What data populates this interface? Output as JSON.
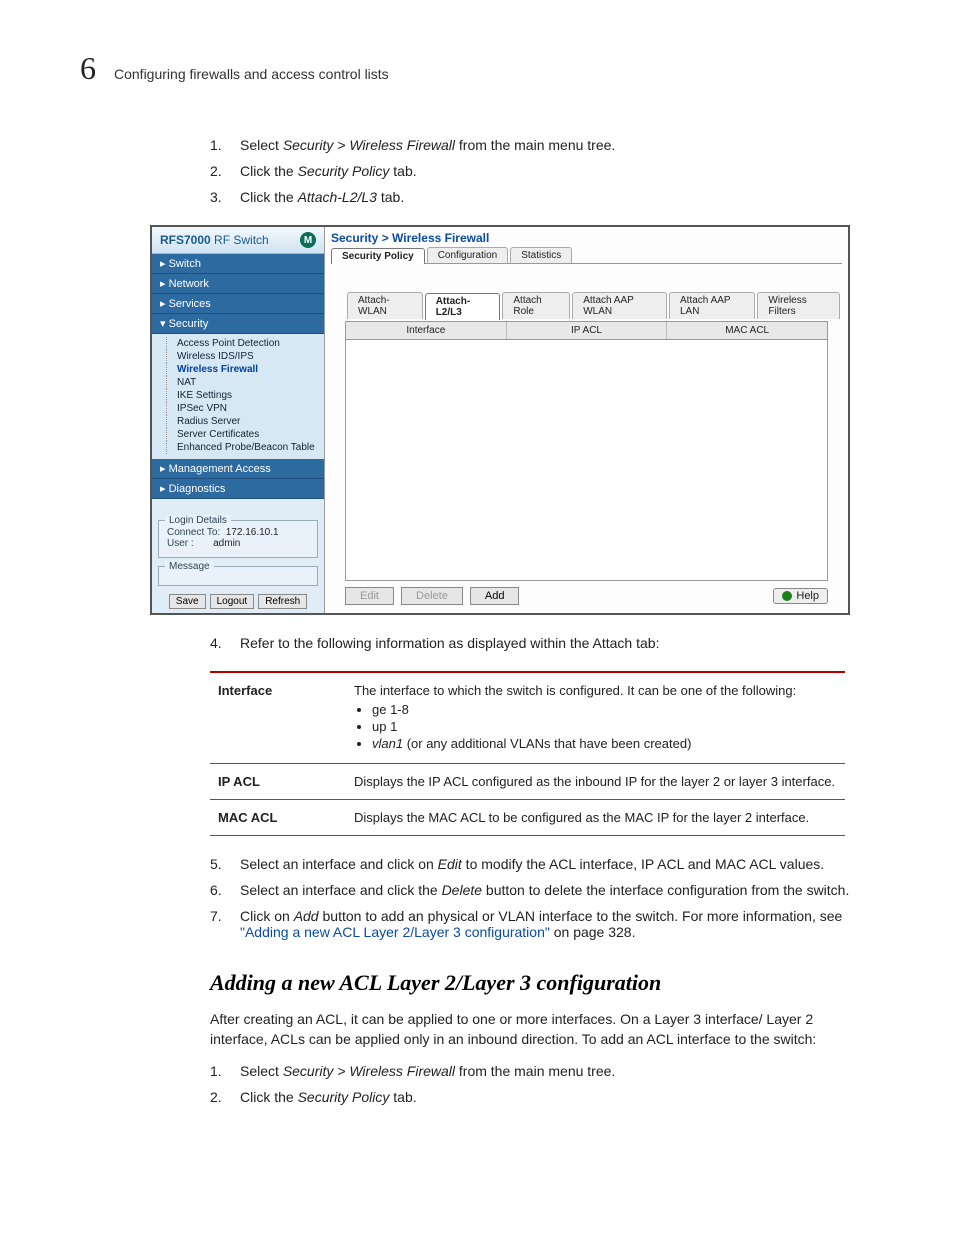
{
  "header": {
    "chapter": "6",
    "title": "Configuring firewalls and access control lists"
  },
  "steps1": [
    {
      "n": "1.",
      "pre": "Select ",
      "em": "Security > Wireless Firewall",
      "post": " from the main menu tree."
    },
    {
      "n": "2.",
      "pre": "Click the ",
      "em": "Security Policy",
      "post": " tab."
    },
    {
      "n": "3.",
      "pre": "Click the ",
      "em": "Attach-L2/L3",
      "post": " tab."
    }
  ],
  "screenshot": {
    "product_a": "RFS7000",
    "product_b": " RF Switch",
    "nav": {
      "switch": "Switch",
      "network": "Network",
      "services": "Services",
      "security": "Security",
      "mgmt": "Management Access",
      "diag": "Diagnostics"
    },
    "tree": {
      "apd": "Access Point Detection",
      "wids": "Wireless IDS/IPS",
      "wf": "Wireless Firewall",
      "nat": "NAT",
      "ike": "IKE Settings",
      "ipsec": "IPSec VPN",
      "radius": "Radius Server",
      "certs": "Server Certificates",
      "probe": "Enhanced Probe/Beacon Table"
    },
    "login": {
      "title": "Login Details",
      "connect_lbl": "Connect To:",
      "connect_val": "172.16.10.1",
      "user_lbl": "User :",
      "user_val": "admin"
    },
    "msg": {
      "title": "Message"
    },
    "btns": {
      "save": "Save",
      "logout": "Logout",
      "refresh": "Refresh"
    },
    "crumb": "Security > Wireless Firewall",
    "top_tabs": {
      "sp": "Security Policy",
      "cfg": "Configuration",
      "stats": "Statistics"
    },
    "sub_tabs": {
      "awlan": "Attach-WLAN",
      "al23": "Attach-L2/L3",
      "arole": "Attach Role",
      "aaapw": "Attach AAP WLAN",
      "aaapl": "Attach AAP LAN",
      "wfilt": "Wireless Filters"
    },
    "cols": {
      "iface": "Interface",
      "ipacl": "IP ACL",
      "macacl": "MAC ACL"
    },
    "actions": {
      "edit": "Edit",
      "delete": "Delete",
      "add": "Add",
      "help": "Help"
    }
  },
  "step4": {
    "n": "4.",
    "text": "Refer to the following information as displayed within the Attach tab:"
  },
  "table": {
    "r1": {
      "k": "Interface",
      "desc": "The interface to which the switch is configured. It can be one of the following:",
      "b1": "ge 1-8",
      "b2": "up 1",
      "b3a": "vlan1",
      "b3b": " (or any additional VLANs that have been created)"
    },
    "r2": {
      "k": "IP ACL",
      "desc": "Displays the IP ACL configured as the inbound IP for the layer 2 or layer 3 interface."
    },
    "r3": {
      "k": "MAC ACL",
      "desc": "Displays the MAC ACL to be configured as the MAC IP for the layer 2 interface."
    }
  },
  "steps2": [
    {
      "n": "5.",
      "pre": "Select an interface and click on ",
      "em": "Edit",
      "post": " to modify the ACL interface, IP ACL and MAC ACL values."
    },
    {
      "n": "6.",
      "pre": "Select an interface and click the ",
      "em": "Delete",
      "post": " button to delete the interface configuration from the switch."
    }
  ],
  "step7": {
    "n": "7.",
    "pre": "Click on ",
    "em": "Add",
    "mid": " button to add an physical or VLAN interface to the switch. For more information, see ",
    "link": "\"Adding a new ACL Layer 2/Layer 3 configuration\"",
    "post": " on page 328."
  },
  "section": "Adding a new ACL Layer 2/Layer 3 configuration",
  "para": "After creating an ACL, it can be applied to one or more interfaces. On a Layer 3 interface/ Layer 2 interface, ACLs can be applied only in an inbound direction. To add an ACL interface to the switch:",
  "steps3": [
    {
      "n": "1.",
      "pre": "Select ",
      "em": "Security > Wireless Firewall",
      "post": " from the main menu tree."
    },
    {
      "n": "2.",
      "pre": "Click the ",
      "em": "Security Policy",
      "post": " tab."
    }
  ]
}
